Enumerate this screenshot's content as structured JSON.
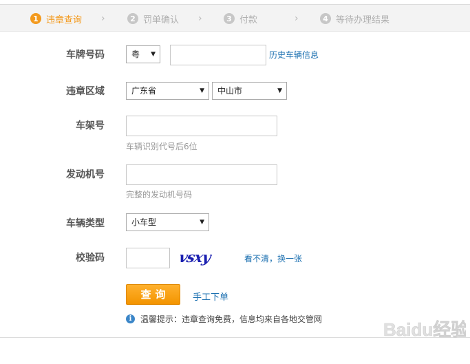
{
  "steps": [
    {
      "num": "1",
      "label": "违章查询",
      "active": true
    },
    {
      "num": "2",
      "label": "罚单确认",
      "active": false
    },
    {
      "num": "3",
      "label": "付款",
      "active": false
    },
    {
      "num": "4",
      "label": "等待办理结果",
      "active": false
    }
  ],
  "step_arrow": "›",
  "form": {
    "plate": {
      "label": "车牌号码",
      "prefix": "粤",
      "value": "",
      "history_link": "历史车辆信息"
    },
    "region": {
      "label": "违章区域",
      "province": "广东省",
      "city": "中山市"
    },
    "frame": {
      "label": "车架号",
      "value": "",
      "hint": "车辆识别代号后6位"
    },
    "engine": {
      "label": "发动机号",
      "value": "",
      "hint": "完整的发动机号码"
    },
    "vehicle_type": {
      "label": "车辆类型",
      "value": "小车型"
    },
    "captcha": {
      "label": "校验码",
      "value": "",
      "image_text": "vsxy",
      "refresh_link": "看不清，换一张"
    }
  },
  "actions": {
    "query_button": "查询",
    "manual_link": "手工下单"
  },
  "tip": {
    "icon": "i",
    "text": "温馨提示：违章查询免费，信息均来自各地交管网"
  },
  "colors": {
    "accent": "#f39a1e",
    "link": "#1a6fb0",
    "button": "#f39400"
  },
  "watermark": "Baidu经验"
}
